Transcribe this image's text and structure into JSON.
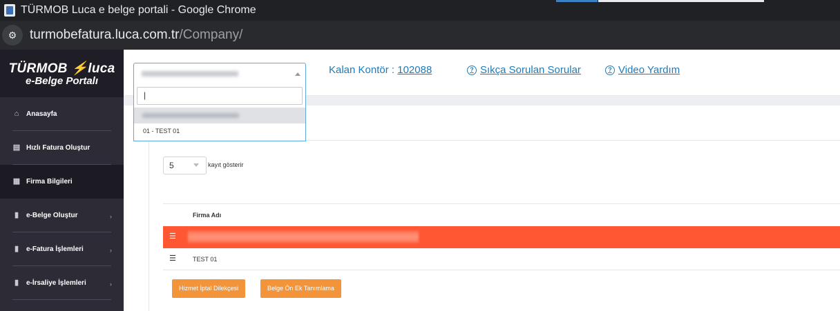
{
  "browser": {
    "window_title": "TÜRMOB Luca e belge portali - Google Chrome",
    "url_host": "turmobefatura.luca.com.tr",
    "url_path": "/Company/"
  },
  "sidebar": {
    "logo_line1": "TÜRMOB ⚡luca",
    "logo_line2": "e-Belge Portalı",
    "items": [
      {
        "label": "Anasayfa",
        "icon": "home-icon"
      },
      {
        "label": "Hızlı Fatura Oluştur",
        "icon": "file-icon"
      },
      {
        "label": "Firma Bilgileri",
        "icon": "building-icon"
      },
      {
        "label": "e-Belge Oluştur",
        "icon": "document-icon"
      },
      {
        "label": "e-Fatura İşlemleri",
        "icon": "document-icon"
      },
      {
        "label": "e-İrsaliye İşlemleri",
        "icon": "document-icon"
      }
    ]
  },
  "header": {
    "kontor_label": "Kalan Kontör :",
    "kontor_value": "102088",
    "faq_link": "Sıkça Sorulan Sorular",
    "video_link": "Video Yardım"
  },
  "company_dropdown": {
    "search_value": "|",
    "options": [
      "01 - TEST 01"
    ]
  },
  "table_controls": {
    "page_length": "5",
    "page_length_label": "kayıt gösterir"
  },
  "table": {
    "column_header": "Firma Adı",
    "rows": [
      {
        "name": ""
      },
      {
        "name": "TEST 01"
      }
    ]
  },
  "actions": {
    "cancel_petition": "Hizmet İptal Dilekçesi",
    "prefix_definition": "Belge Ön Ek Tanımlama"
  },
  "colors": {
    "accent_orange": "#f3943a",
    "selected_row": "#ff5733",
    "link_blue": "#1f7ab7",
    "sidebar_bg": "#2c2b36"
  }
}
